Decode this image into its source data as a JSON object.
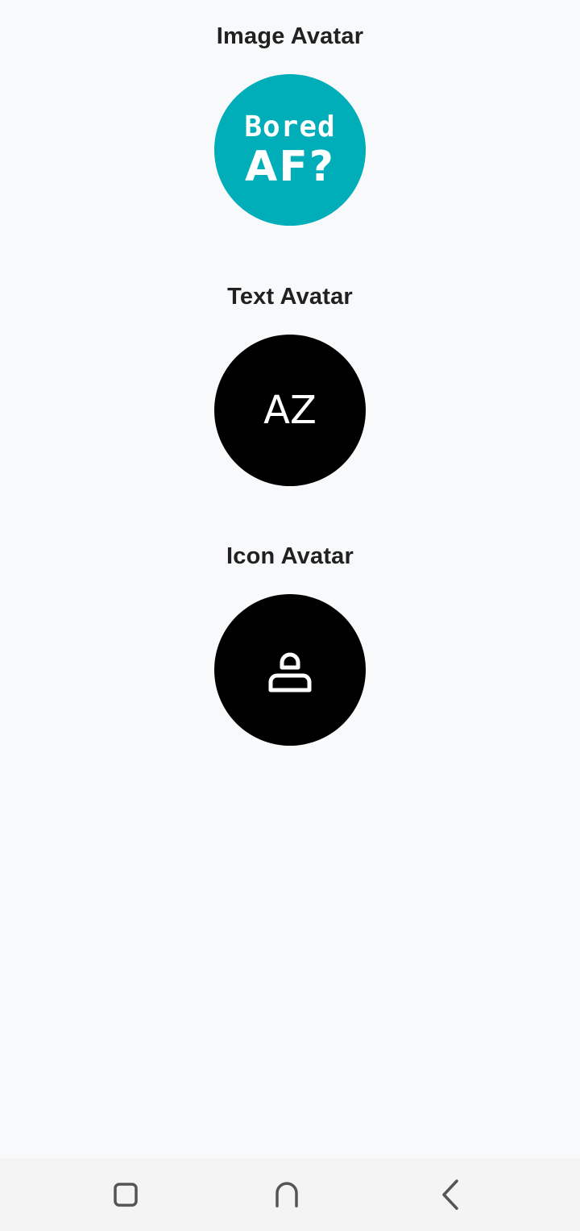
{
  "sections": {
    "image": {
      "title": "Image Avatar",
      "image_text_line1": "Bored",
      "image_text_line2": "AF?",
      "background": "#00aeb9"
    },
    "text": {
      "title": "Text Avatar",
      "initials": "AZ",
      "background": "#000000"
    },
    "icon": {
      "title": "Icon Avatar",
      "icon": "person-icon",
      "background": "#000000"
    }
  },
  "navbar": {
    "recents_icon": "square-icon",
    "home_icon": "home-icon",
    "back_icon": "chevron-left-icon"
  }
}
